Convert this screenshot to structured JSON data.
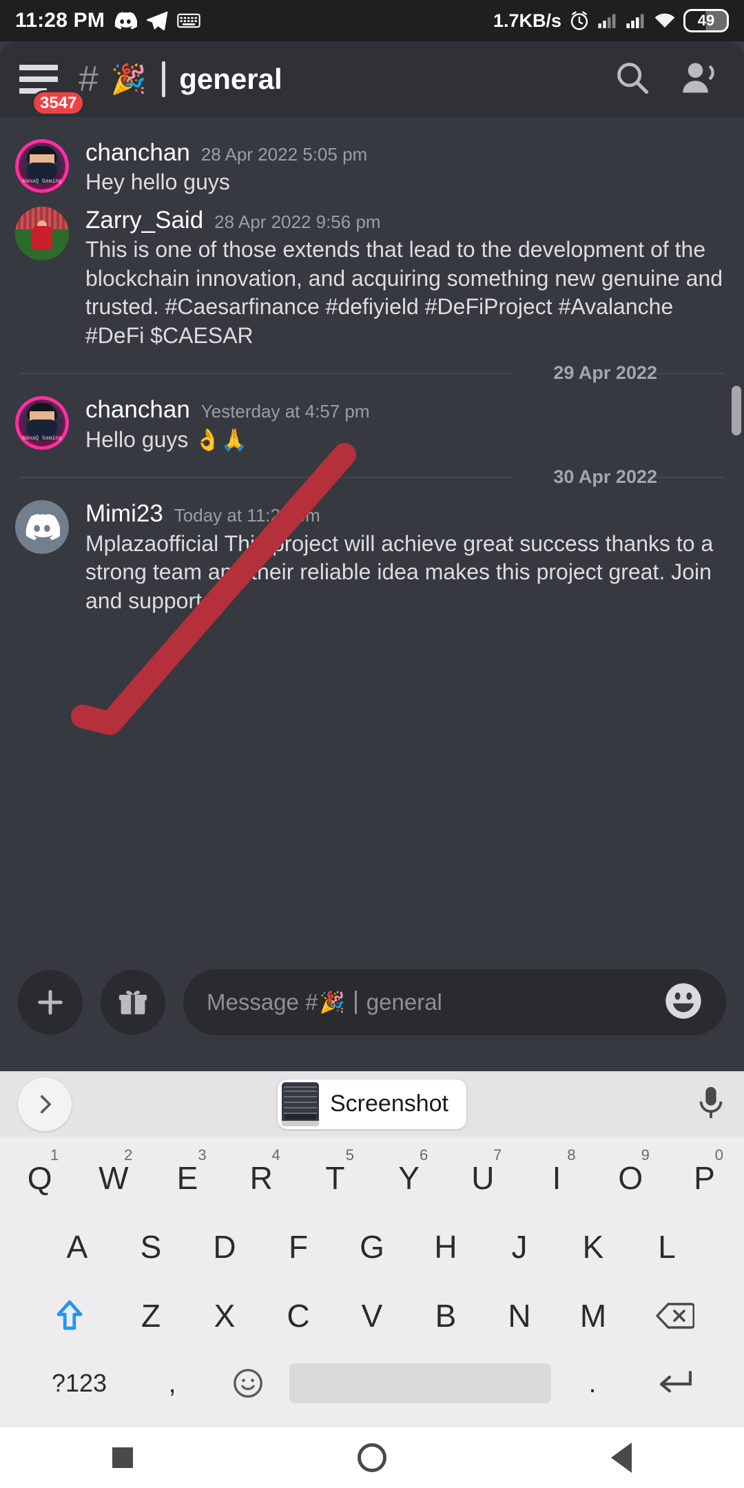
{
  "status_bar": {
    "time": "11:28 PM",
    "left_icons": [
      "discord-icon",
      "telegram-icon",
      "keyboard-icon"
    ],
    "net_speed": "1.7KB/s",
    "right_icons": [
      "alarm-icon",
      "signal-sim1-icon",
      "signal-sim2-icon",
      "wifi-icon"
    ],
    "battery_level": "49"
  },
  "header": {
    "menu_badge": "3547",
    "hash": "#",
    "channel_emoji": "🎉",
    "channel_name": "general",
    "search_icon": "search-icon",
    "members_icon": "members-icon"
  },
  "messages": [
    {
      "id": "msg-chanchan-1",
      "author": "chanchan",
      "timestamp": "28 Apr 2022 5:05 pm",
      "text": "Hey hello guys",
      "avatar": "chanchan-avatar",
      "avatar_tag": "NanaQ Gaming"
    },
    {
      "id": "msg-zarry",
      "author": "Zarry_Said",
      "timestamp": "28 Apr 2022 9:56 pm",
      "text": "This is one of those extends that lead to the development of the blockchain innovation, and acquiring something new genuine and trusted. #Caesarfinance #defiyield #DeFiProject #Avalanche #DeFi $CAESAR",
      "avatar": "zarry-avatar"
    },
    {
      "id": "divider-29apr",
      "type": "date-divider",
      "label": "29 Apr 2022"
    },
    {
      "id": "msg-chanchan-2",
      "author": "chanchan",
      "timestamp": "Yesterday at 4:57 pm",
      "text": "Hello guys ",
      "emojis": "👌🙏",
      "avatar": "chanchan-avatar",
      "avatar_tag": "NanaQ Gaming"
    },
    {
      "id": "divider-30apr",
      "type": "date-divider",
      "label": "30 Apr 2022"
    },
    {
      "id": "msg-mimi23",
      "author": "Mimi23",
      "timestamp": "Today at 11:28 pm",
      "text": "Mplazaofficial This project will achieve great success thanks to a strong team and their reliable idea makes this project great. Join and support",
      "avatar": "discord-default-avatar"
    }
  ],
  "composer": {
    "add_icon": "plus-icon",
    "gift_icon": "gift-icon",
    "placeholder_prefix": "Message #",
    "placeholder_emoji": "🎉",
    "placeholder_channel": "general",
    "emoji_icon": "emoji-icon"
  },
  "keyboard": {
    "suggestion_chip": "Screenshot",
    "expand_icon": "chevron-right-icon",
    "mic_icon": "microphone-icon",
    "row1": [
      {
        "letter": "Q",
        "num": "1"
      },
      {
        "letter": "W",
        "num": "2"
      },
      {
        "letter": "E",
        "num": "3"
      },
      {
        "letter": "R",
        "num": "4"
      },
      {
        "letter": "T",
        "num": "5"
      },
      {
        "letter": "Y",
        "num": "6"
      },
      {
        "letter": "U",
        "num": "7"
      },
      {
        "letter": "I",
        "num": "8"
      },
      {
        "letter": "O",
        "num": "9"
      },
      {
        "letter": "P",
        "num": "0"
      }
    ],
    "row2": [
      "A",
      "S",
      "D",
      "F",
      "G",
      "H",
      "J",
      "K",
      "L"
    ],
    "row3": [
      "Z",
      "X",
      "C",
      "V",
      "B",
      "N",
      "M"
    ],
    "shift_key": "shift-icon",
    "backspace_key": "backspace-icon",
    "symbols_key": "?123",
    "comma_key": ",",
    "emoji_key": "emoji-key-icon",
    "space_key": "",
    "period_key": ".",
    "enter_key": "enter-icon"
  },
  "navbar": {
    "recents": "recents-square-icon",
    "home": "home-circle-icon",
    "back": "back-triangle-icon"
  },
  "colors": {
    "discord_dark": "#36393f",
    "discord_header": "#2f3136",
    "badge_red": "#ed4245",
    "annotation_red": "#b5303a",
    "accent_blue": "#2196f3"
  },
  "annotation": {
    "shape": "red-check-stroke"
  }
}
